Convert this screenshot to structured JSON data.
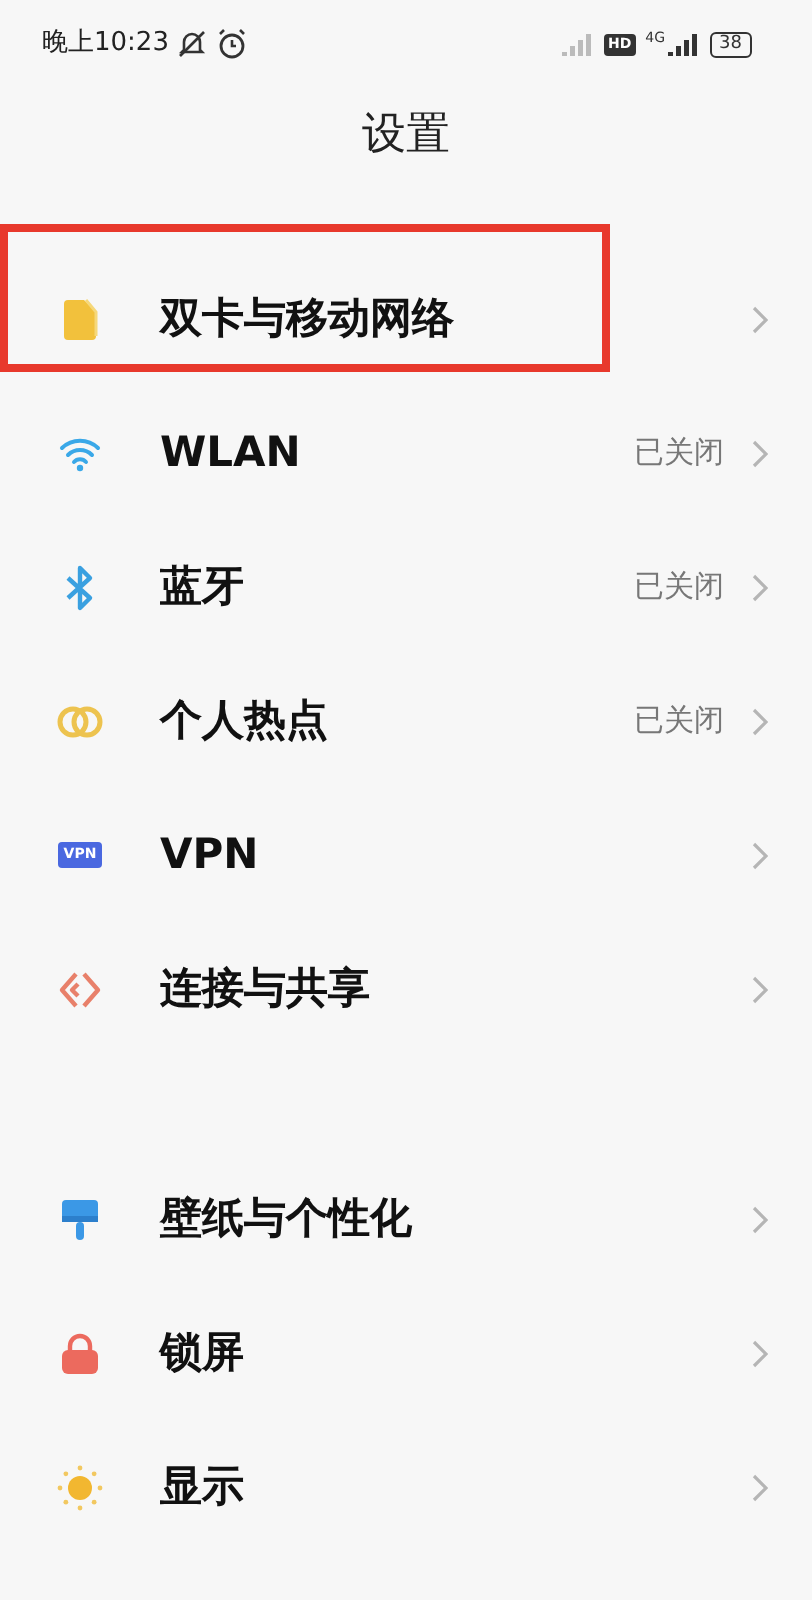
{
  "status_bar": {
    "time": "晚上10:23",
    "hd": "HD",
    "network": "4G",
    "battery": "38"
  },
  "title": "设置",
  "sections": [
    {
      "items": [
        {
          "label": "双卡与移动网络",
          "highlighted": true
        },
        {
          "label": "WLAN",
          "value": "已关闭",
          "highlighted": false
        },
        {
          "label": "蓝牙",
          "value": "已关闭",
          "highlighted": false
        },
        {
          "label": "个人热点",
          "value": "已关闭",
          "highlighted": false
        },
        {
          "label": "VPN",
          "icon_text": "VPN",
          "highlighted": false
        },
        {
          "label": "连接与共享",
          "highlighted": false
        }
      ]
    },
    {
      "items": [
        {
          "label": "壁纸与个性化",
          "highlighted": false
        },
        {
          "label": "锁屏",
          "highlighted": false
        },
        {
          "label": "显示",
          "highlighted": false
        }
      ]
    }
  ]
}
